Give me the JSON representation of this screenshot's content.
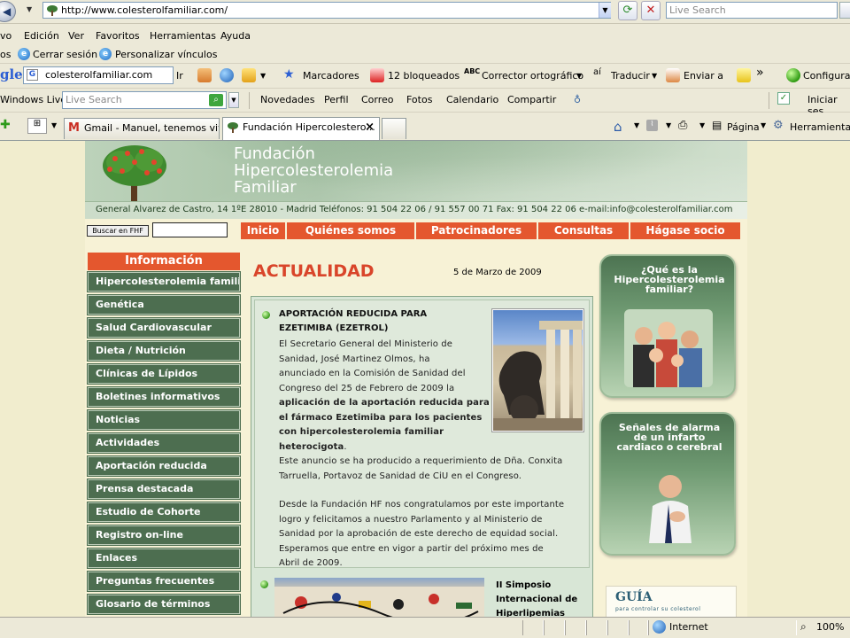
{
  "browser": {
    "url": "http://www.colesterolfamiliar.com/",
    "live_search_placeholder": "Live Search",
    "menu": [
      "vo",
      "Edición",
      "Ver",
      "Favoritos",
      "Herramientas",
      "Ayuda"
    ],
    "links": {
      "favorites_label": "os",
      "item1": "Cerrar sesión",
      "item2": "Personalizar vínculos"
    },
    "google_toolbar": {
      "logo": "gle",
      "search_value": "colesterolfamiliar.com",
      "ir_label": "Ir",
      "bookmarks": "Marcadores",
      "blocked": "12 bloqueados",
      "spellcheck": "Corrector ortográfico",
      "translate": "Traducir",
      "send": "Enviar a",
      "more": "»",
      "config": "Configurac"
    },
    "windows_live": {
      "label": "Windows Live",
      "search_placeholder": "Live Search",
      "items": [
        "Novedades",
        "Perfil",
        "Correo",
        "Fotos",
        "Calendario",
        "Compartir"
      ],
      "signin": "Iniciar ses"
    },
    "tabs": [
      {
        "label": "Gmail - Manuel, tenemos vivi..."
      },
      {
        "label": "Fundación Hipercolestero...",
        "close": "×"
      }
    ],
    "tools_right": {
      "page": "Página",
      "tools": "Herramientas"
    },
    "status": {
      "zone": "Internet",
      "zoom": "100%"
    }
  },
  "site": {
    "brand": [
      "Fundación",
      "Hipercolesterolemia",
      "Familiar"
    ],
    "address_line": "General Alvarez de Castro, 14 1ºE  28010 - Madrid Teléfonos: 91 504 22 06  /  91 557 00 71  Fax: 91 504 22 06  e-mail:info@colesterolfamiliar.com",
    "search_button": "Buscar en FHF",
    "top_nav": [
      "Inicio",
      "Quiénes somos",
      "Patrocinadores",
      "Consultas",
      "Hágase socio"
    ],
    "sidebar": {
      "heading": "Información",
      "items": [
        "Hipercolesterolemia familiar",
        "Genética",
        "Salud Cardiovascular",
        "Dieta / Nutrición",
        "Clínicas de Lípidos",
        "Boletines informativos",
        "Noticias",
        "Actividades",
        "Aportación reducida",
        "Prensa destacada",
        "Estudio de Cohorte",
        "Registro on-line",
        "Enlaces",
        "Preguntas frecuentes",
        "Glosario de términos"
      ]
    },
    "section_title": "ACTUALIDAD",
    "date": "5 de Marzo de 2009",
    "news": [
      {
        "title_lines": [
          "APORTACIÓN REDUCIDA PARA",
          "EZETIMIBA (EZETROL)"
        ],
        "body_lines": [
          "El Secretario General del Ministerio de",
          "Sanidad, José Martinez Olmos, ha",
          "anunciado en la Comisión de Sanidad del",
          "Congreso del 25 de Febrero de 2009 la"
        ],
        "bold_lines": [
          "aplicación de la aportación reducida para",
          "el fármaco Ezetimiba para los pacientes",
          "con hipercolesterolemia familiar",
          "heterocigota"
        ],
        "bold_tail": ".",
        "paragraph2": [
          "Este anuncio se ha producido a requerimiento de Dña. Conxita",
          "Tarruella, Portavoz de Sanidad de CiU en el Congreso."
        ],
        "paragraph3": [
          "Desde la Fundación HF nos congratulamos por este importante",
          "logro y felicitamos a nuestro Parlamento y al Ministerio de",
          "Sanidad por la aprobación de este derecho de equidad social.",
          "Esperamos que entre en vigor a partir del próximo mes de",
          "Abril de 2009."
        ]
      },
      {
        "title_lines": [
          "II Simposio",
          "Internacional de",
          "Hiperlipemias"
        ]
      }
    ],
    "right_boxes": [
      {
        "title_lines": [
          "¿Qué es la",
          "Hipercolesterolemia",
          "familiar?"
        ]
      },
      {
        "title_lines": [
          "Señales de alarma",
          "de un infarto",
          "cardiaco o cerebral"
        ]
      }
    ],
    "guide": {
      "title": "GUÍA",
      "subtitle": "para controlar su colesterol"
    }
  },
  "colors": {
    "accent_orange": "#e4572e",
    "sidebar_green": "#4d6e50",
    "page_bg": "#f7f2d6"
  }
}
